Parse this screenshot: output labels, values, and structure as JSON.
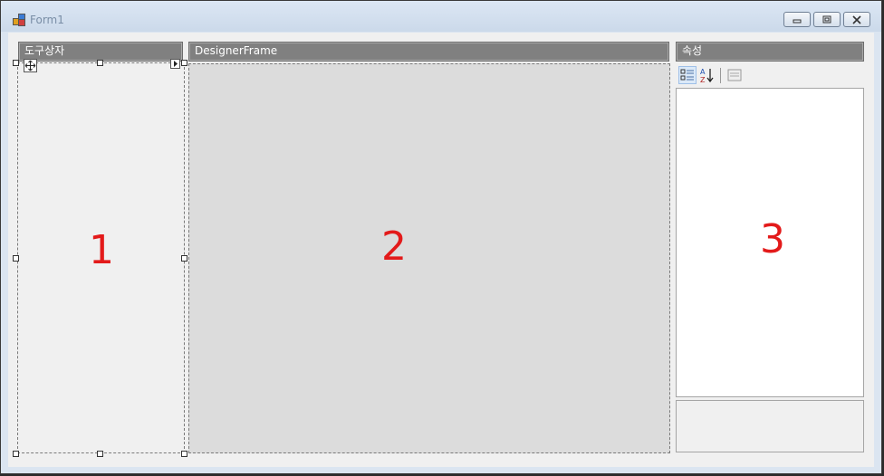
{
  "window": {
    "title": "Form1",
    "buttons": [
      "minimize",
      "maximize",
      "close"
    ]
  },
  "toolbox": {
    "header": "도구상자",
    "annotation": "1"
  },
  "designer": {
    "header": "DesignerFrame",
    "annotation": "2"
  },
  "properties": {
    "header": "속성",
    "toolbar": [
      "categorized-icon",
      "alphabetical-icon",
      "property-pages-icon"
    ],
    "annotation": "3"
  },
  "colors": {
    "annotation": "#e31a1a",
    "header_bg": "#808080",
    "designer_bg": "#dcdcdc"
  }
}
